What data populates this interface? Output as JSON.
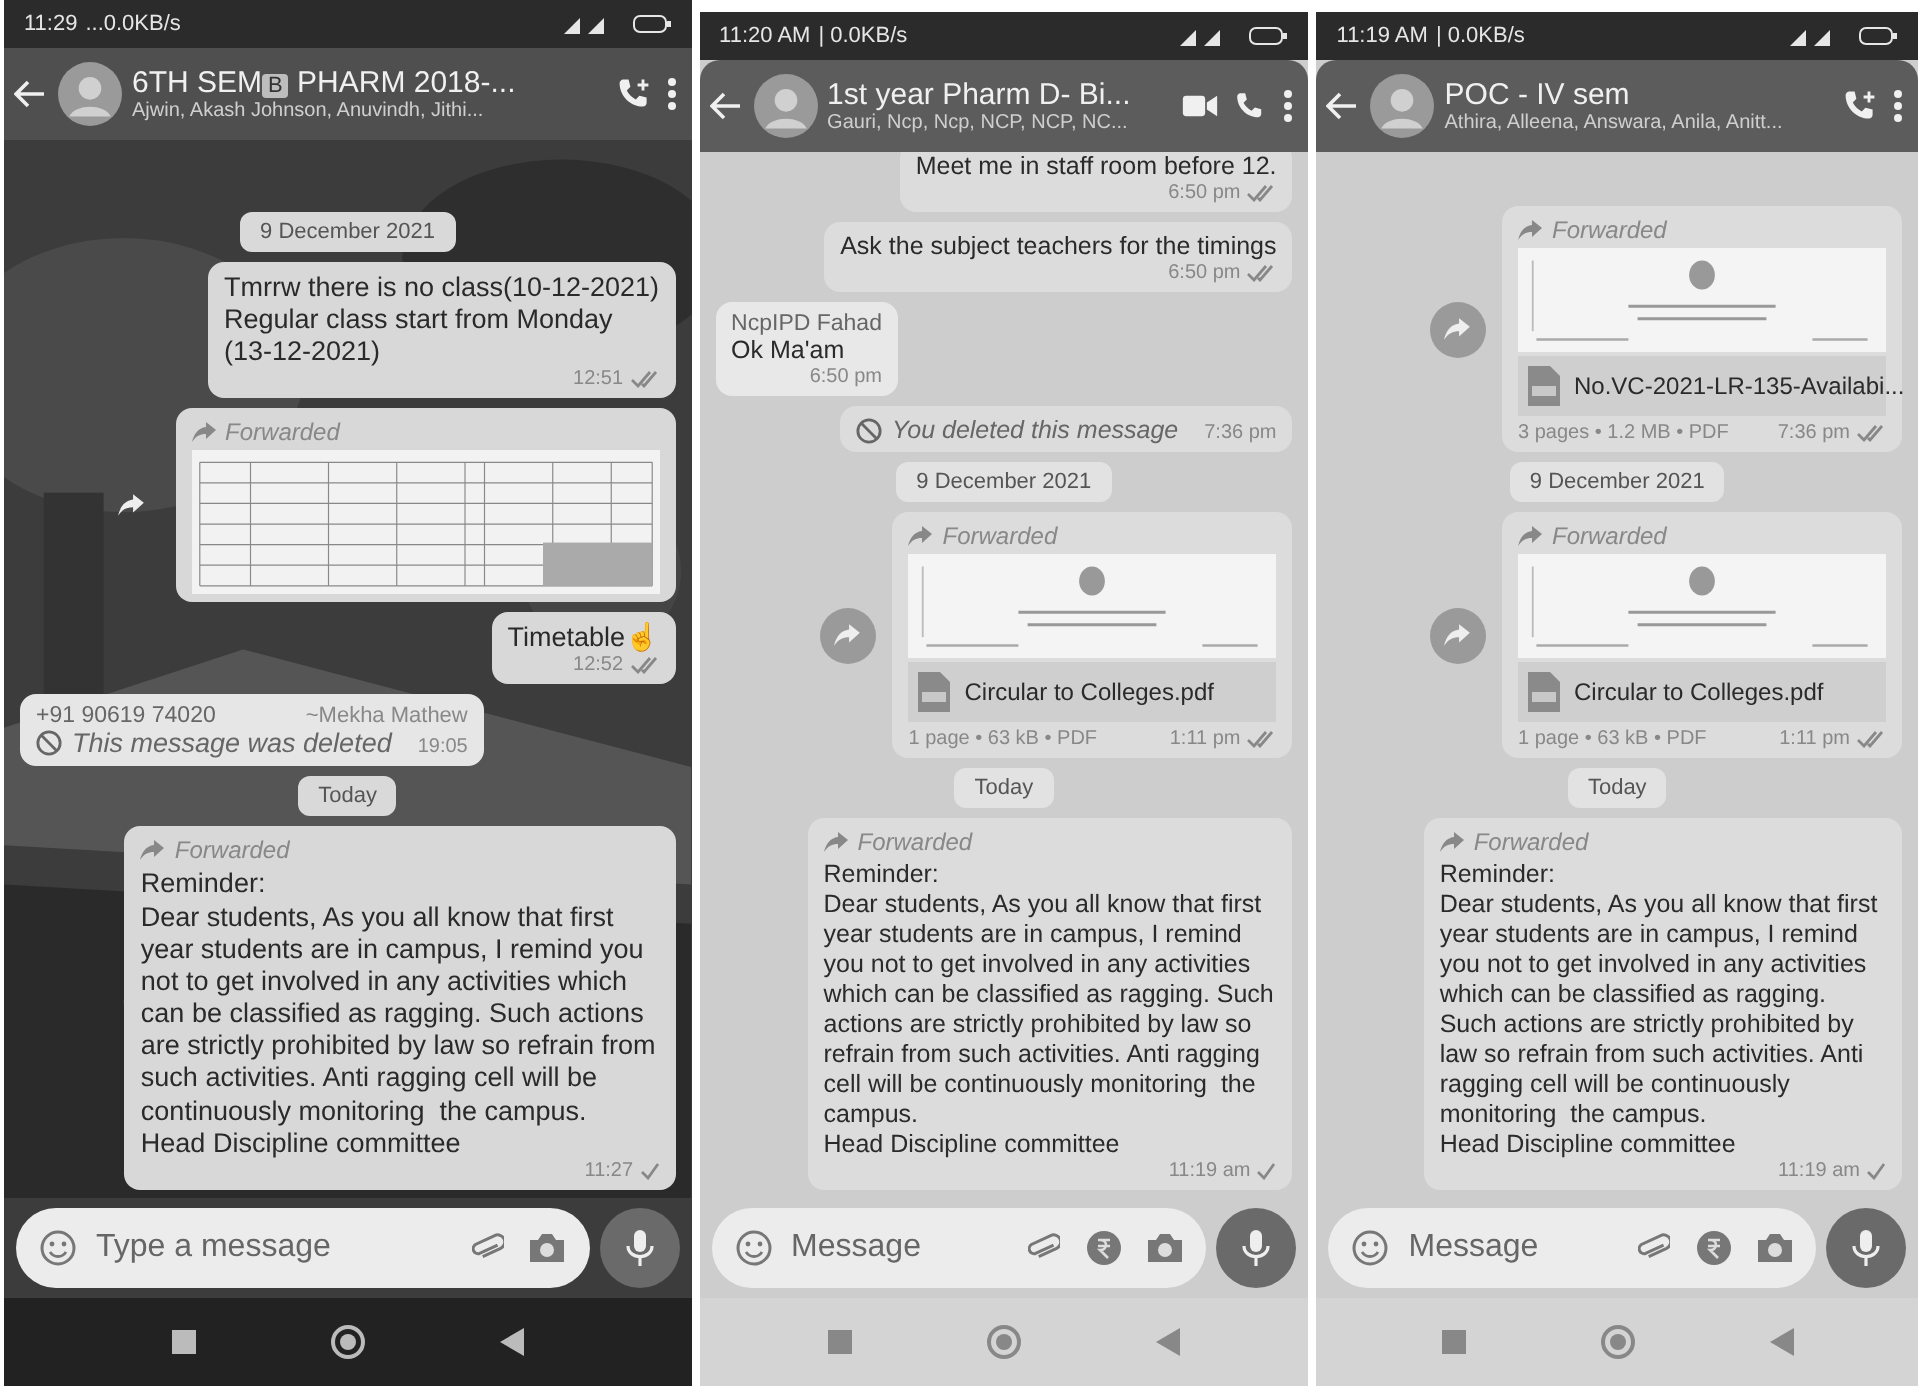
{
  "screens": [
    {
      "wallpaper": true,
      "status": {
        "time": "11:29",
        "network": "...0.0KB/s"
      },
      "header": {
        "title": "6TH SEM",
        "title_badge": "B",
        "title_rest": "PHARM 2018-...",
        "subtitle": "Ajwin, Akash Johnson, Anuvindh, Jithi...",
        "actions": [
          {
            "kind": "add_call"
          },
          {
            "kind": "menu"
          }
        ]
      },
      "messages": [
        {
          "kind": "date",
          "text": "9 December 2021"
        },
        {
          "kind": "text",
          "outgoing": true,
          "text": "Tmrrw there is no class(10-12-2021)\nRegular class start from Monday\n(13-12-2021)",
          "time": "12:51",
          "delivered": true
        },
        {
          "outgoing": true,
          "forwarded_label": "Forwarded"
        },
        {
          "kind": "text",
          "outgoing": true,
          "text": "Timetable☝",
          "time": "12:52",
          "delivered": true
        },
        {
          "kind": "deleted",
          "outgoing": false,
          "sender": "+91 90619 74020",
          "sender_name": "~Mekha Mathew",
          "text": "This message was deleted",
          "time": "19:05"
        },
        {
          "kind": "date",
          "text": "Today"
        },
        {
          "kind": "text",
          "outgoing": true,
          "forwarded_label": "Forwarded",
          "text": "Reminder:\nDear students, As you all know that first year students are in campus, I remind you not to get involved in any activities which can be classified as ragging. Such actions are strictly prohibited by law so refrain from such activities. Anti ragging cell will be continuously monitoring  the campus.\nHead Discipline committee",
          "time": "11:27",
          "delivered": false
        }
      ],
      "composer": {
        "placeholder": "Type a message",
        "tools": [
          {
            "kind": "attach"
          },
          {
            "kind": "camera"
          }
        ]
      }
    },
    {
      "wallpaper": false,
      "status": {
        "time": "11:20 AM",
        "network": "| 0.0KB/s"
      },
      "header": {
        "title": "1st year Pharm D- Bi...",
        "subtitle": "Gauri, Ncp, Ncp, NCP, NCP, NC...",
        "actions": [
          {
            "kind": "video"
          },
          {
            "kind": "call"
          },
          {
            "kind": "menu"
          }
        ]
      },
      "messages": [
        {
          "kind": "text",
          "outgoing": true,
          "text": "Meet me in staff room before 12.",
          "time": "6:50 pm",
          "delivered": true
        },
        {
          "kind": "text",
          "outgoing": true,
          "text": "Ask the subject teachers for the timings",
          "time": "6:50 pm",
          "delivered": true
        },
        {
          "kind": "text",
          "outgoing": false,
          "sender": "NcpIPD Fahad",
          "text": "Ok Ma'am",
          "time": "6:50 pm"
        },
        {
          "kind": "deleted",
          "outgoing": true,
          "text": "You deleted this message",
          "time": "7:36 pm"
        },
        {
          "kind": "date",
          "text": "9 December 2021"
        },
        {
          "kind": "document",
          "outgoing": true,
          "forwarded_label": "Forwarded",
          "file_name": "Circular to Colleges.pdf",
          "meta": "1 page • 63 kB • PDF",
          "time": "1:11 pm",
          "delivered": true
        },
        {
          "kind": "date",
          "text": "Today"
        },
        {
          "kind": "text",
          "outgoing": true,
          "forwarded_label": "Forwarded",
          "text": "Reminder:\nDear students, As you all know that first year students are in campus, I remind you not to get involved in any activities which can be classified as ragging. Such actions are strictly prohibited by law so refrain from such activities. Anti ragging cell will be continuously monitoring  the campus.\nHead Discipline committee",
          "time": "11:19 am",
          "delivered": false
        }
      ],
      "composer": {
        "placeholder": "Message",
        "tools": [
          {
            "kind": "attach"
          },
          {
            "kind": "payment"
          },
          {
            "kind": "camera"
          }
        ]
      }
    },
    {
      "wallpaper": false,
      "status": {
        "time": "11:19 AM",
        "network": "| 0.0KB/s"
      },
      "header": {
        "title": "POC - IV sem",
        "subtitle": "Athira, Alleena, Answara, Anila, Anitt...",
        "actions": [
          {
            "kind": "add_call"
          },
          {
            "kind": "menu"
          }
        ]
      },
      "messages": [
        {
          "kind": "document",
          "outgoing": true,
          "forwarded_label": "Forwarded",
          "file_name": "No.VC-2021-LR-135-Availabi...",
          "meta": "3 pages • 1.2 MB • PDF",
          "time": "7:36 pm",
          "delivered": true
        },
        {
          "kind": "date",
          "text": "9 December 2021"
        },
        {
          "kind": "document",
          "outgoing": true,
          "forwarded_label": "Forwarded",
          "file_name": "Circular to Colleges.pdf",
          "meta": "1 page • 63 kB • PDF",
          "time": "1:11 pm",
          "delivered": true
        },
        {
          "kind": "date",
          "text": "Today"
        },
        {
          "kind": "text",
          "outgoing": true,
          "forwarded_label": "Forwarded",
          "text": "Reminder:\nDear students, As you all know that first year students are in campus, I remind you not to get involved in any activities which can be classified as ragging. Such actions are strictly prohibited by law so refrain from such activities. Anti ragging cell will be continuously monitoring  the campus.\nHead Discipline committee",
          "time": "11:19 am",
          "delivered": false
        }
      ],
      "composer": {
        "placeholder": "Message",
        "tools": [
          {
            "kind": "attach"
          },
          {
            "kind": "payment"
          },
          {
            "kind": "camera"
          }
        ]
      }
    }
  ]
}
